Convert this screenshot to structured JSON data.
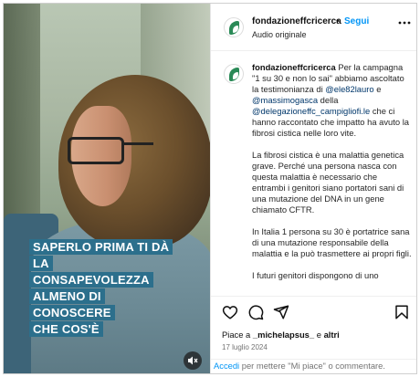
{
  "video": {
    "caption_lines": [
      "SAPERLO PRIMA TI DÀ LA",
      "CONSAPEVOLEZZA",
      "ALMENO DI CONOSCERE",
      "CHE COS'È"
    ],
    "mute_icon": "speaker-muted-icon"
  },
  "header": {
    "username": "fondazioneffcricerca",
    "dot": "•",
    "follow_label": "Segui",
    "audio_label": "Audio originale",
    "more_icon": "more-options-icon"
  },
  "post": {
    "username": "fondazioneffcricerca",
    "intro_a": "Per la campagna \"1 su 30 e non lo sai\" abbiamo ascoltato la testimonianza di",
    "mention_1": "@ele82lauro",
    "intro_b": "e",
    "mention_2": "@massimogasca",
    "intro_c": "della",
    "mention_3": "@delegazioneffc_campigliofi.le",
    "intro_d": "che ci hanno raccontato che impatto ha avuto la fibrosi cistica nelle loro vite.",
    "para_2": "La fibrosi cistica è una malattia genetica grave. Perché una persona nasca con questa malattia è necessario che entrambi i genitori siano portatori sani di una mutazione del DNA in un gene chiamato CFTR.",
    "para_3": "In Italia 1 persona su 30 è portatrice sana di una mutazione responsabile della malattia e la può trasmettere ai propri figli.",
    "para_4": "I futuri genitori dispongono di uno"
  },
  "actions": {
    "like_icon": "heart-icon",
    "comment_icon": "comment-icon",
    "share_icon": "send-icon",
    "save_icon": "bookmark-icon"
  },
  "likes": {
    "prefix": "Piace a",
    "user": "_michelapsus_",
    "middle": "e",
    "others": "altri"
  },
  "date": "17 luglio 2024",
  "login": {
    "link": "Accedi",
    "text": "per mettere \"Mi piace\" o commentare."
  },
  "colors": {
    "accent": "#0095f6",
    "mention": "#00376b",
    "caption_bg": "#2c6f8c",
    "brand_leaf": "#2a8a57"
  }
}
